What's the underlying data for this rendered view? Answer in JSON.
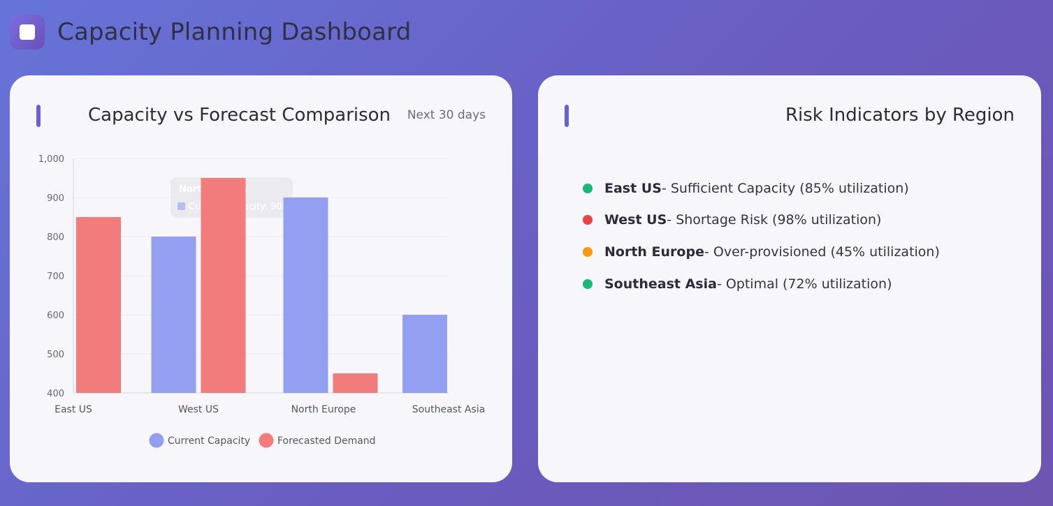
{
  "header": {
    "title": "Capacity Planning Dashboard"
  },
  "capacity_card": {
    "title": "Capacity vs Forecast Comparison",
    "subtitle": "Next 30 days"
  },
  "tooltip": {
    "title": "North Europe",
    "line": "Current Capacity: 900"
  },
  "chart_data": {
    "type": "bar",
    "categories": [
      "East US",
      "West US",
      "North Europe",
      "Southeast Asia"
    ],
    "series": [
      {
        "name": "Current Capacity",
        "color": "#939ff0",
        "values": [
          null,
          800,
          900,
          600
        ]
      },
      {
        "name": "Forecasted Demand",
        "color": "#f27b7b",
        "values": [
          850,
          950,
          450,
          null
        ]
      }
    ],
    "ylim": [
      400,
      1000
    ],
    "yticks": [
      "1,000",
      "900",
      "800",
      "700",
      "600",
      "500",
      "400"
    ],
    "grid": true,
    "legend": "bottom"
  },
  "risk_card": {
    "title": "Risk Indicators by Region",
    "items": [
      {
        "region": "East US",
        "text": " - Sufficient Capacity (85% utilization)",
        "color": "#19b77a"
      },
      {
        "region": "West US",
        "text": " - Shortage Risk (98% utilization)",
        "color": "#e84444"
      },
      {
        "region": "North Europe",
        "text": " - Over-provisioned (45% utilization)",
        "color": "#f39c12"
      },
      {
        "region": "Southeast Asia",
        "text": " - Optimal (72% utilization)",
        "color": "#19b77a"
      }
    ]
  }
}
